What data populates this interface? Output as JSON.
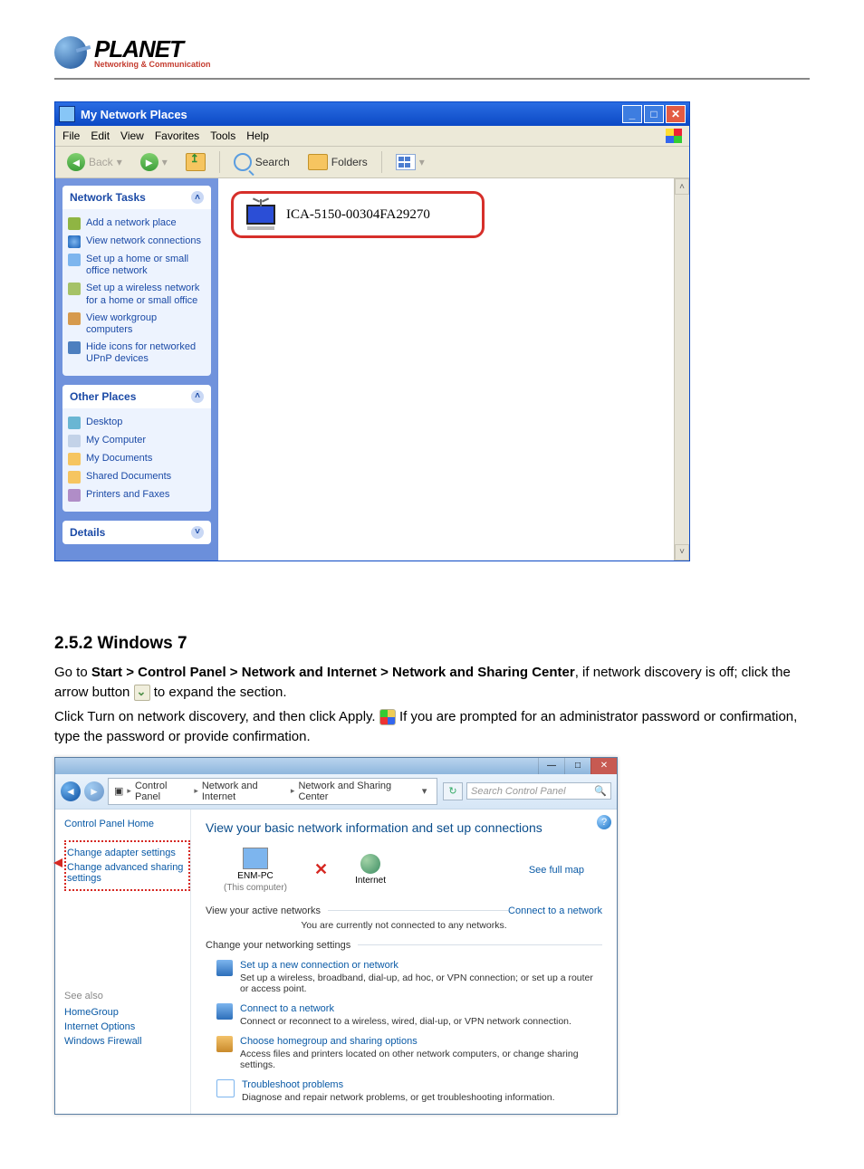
{
  "logo": {
    "brand": "PLANET",
    "tagline": "Networking & Communication"
  },
  "xp": {
    "title": "My Network Places",
    "menu": [
      "File",
      "Edit",
      "View",
      "Favorites",
      "Tools",
      "Help"
    ],
    "toolbar": {
      "back": "Back",
      "search": "Search",
      "folders": "Folders"
    },
    "panels": {
      "tasks": {
        "title": "Network Tasks",
        "items": [
          "Add a network place",
          "View network connections",
          "Set up a home or small office network",
          "Set up a wireless network for a home or small office",
          "View workgroup computers",
          "Hide icons for networked UPnP devices"
        ]
      },
      "places": {
        "title": "Other Places",
        "items": [
          "Desktop",
          "My Computer",
          "My Documents",
          "Shared Documents",
          "Printers and Faxes"
        ]
      },
      "details": {
        "title": "Details"
      }
    },
    "device_label": "ICA-5150-00304FA29270"
  },
  "section": {
    "heading": "2.5.2 Windows 7",
    "p1a": "Go to ",
    "p1b": "Start > Control Panel > Network and Internet > Network and Sharing Center",
    "p1c": ", if network discovery is off; click the arrow button ",
    "p1d": " to expand the section.",
    "p2a": "Click Turn on network discovery, and then click Apply. ",
    "p2b": " If you are prompted for an administrator password or confirmation, type the password or provide confirmation."
  },
  "w7": {
    "breadcrumb": [
      "Control Panel",
      "Network and Internet",
      "Network and Sharing Center"
    ],
    "search_placeholder": "Search Control Panel",
    "side": {
      "home": "Control Panel Home",
      "change_adapter": "Change adapter settings",
      "change_sharing": "Change advanced sharing settings",
      "see_also_title": "See also",
      "see_also": [
        "HomeGroup",
        "Internet Options",
        "Windows Firewall"
      ]
    },
    "main": {
      "heading": "View your basic network information and set up connections",
      "full_map": "See full map",
      "pc_name": "ENM-PC",
      "pc_sub": "(This computer)",
      "internet": "Internet",
      "active_nets_label": "View your active networks",
      "connect_link": "Connect to a network",
      "active_nets_msg": "You are currently not connected to any networks.",
      "change_settings_label": "Change your networking settings",
      "opts": [
        {
          "t": "Set up a new connection or network",
          "d": "Set up a wireless, broadband, dial-up, ad hoc, or VPN connection; or set up a router or access point."
        },
        {
          "t": "Connect to a network",
          "d": "Connect or reconnect to a wireless, wired, dial-up, or VPN network connection."
        },
        {
          "t": "Choose homegroup and sharing options",
          "d": "Access files and printers located on other network computers, or change sharing settings."
        },
        {
          "t": "Troubleshoot problems",
          "d": "Diagnose and repair network problems, or get troubleshooting information."
        }
      ]
    }
  }
}
